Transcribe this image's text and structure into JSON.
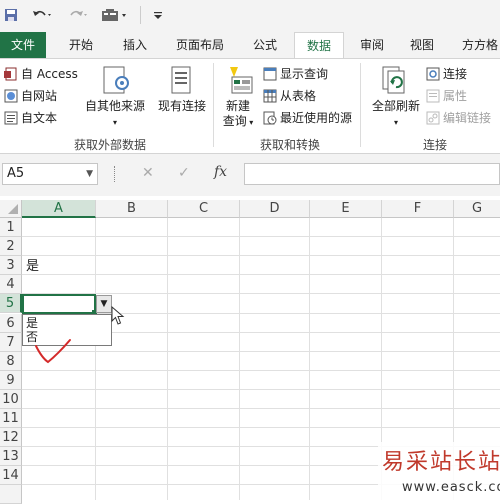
{
  "quick_access": {
    "icons": [
      "save-icon",
      "undo-icon",
      "redo-icon",
      "form-icon",
      "customize-icon"
    ]
  },
  "tabs": [
    {
      "label": "文件"
    },
    {
      "label": "开始"
    },
    {
      "label": "插入"
    },
    {
      "label": "页面布局"
    },
    {
      "label": "公式"
    },
    {
      "label": "数据"
    },
    {
      "label": "审阅"
    },
    {
      "label": "视图"
    },
    {
      "label": "方方格"
    }
  ],
  "active_tab": "数据",
  "ribbon": {
    "get_external": {
      "access": "自 Access",
      "web": "自网站",
      "text": "自文本",
      "other_sources": "自其他来源",
      "existing_connections": "现有连接",
      "group_label": "获取外部数据"
    },
    "get_transform": {
      "new_query_line1": "新建",
      "new_query_line2": "查询",
      "show_queries": "显示查询",
      "from_table": "从表格",
      "recent_sources": "最近使用的源",
      "group_label": "获取和转换"
    },
    "connections": {
      "refresh_all": "全部刷新",
      "connections": "连接",
      "properties": "属性",
      "edit_links": "编辑链接",
      "group_label": "连接"
    }
  },
  "formula_bar": {
    "name_box": "A5",
    "cancel_icon": "✕",
    "enter_icon": "✓",
    "fx_label": "fx",
    "formula": ""
  },
  "sheet": {
    "columns": [
      "A",
      "B",
      "C",
      "D",
      "E",
      "F",
      "G"
    ],
    "rows": [
      "1",
      "2",
      "3",
      "4",
      "5",
      "6",
      "7",
      "8",
      "9",
      "10",
      "11",
      "12",
      "13",
      "14"
    ],
    "cell_a3": "是",
    "dropdown_options": [
      "是",
      "否"
    ]
  },
  "watermark": {
    "title": "易采站长站",
    "url": "www.easck.com"
  }
}
